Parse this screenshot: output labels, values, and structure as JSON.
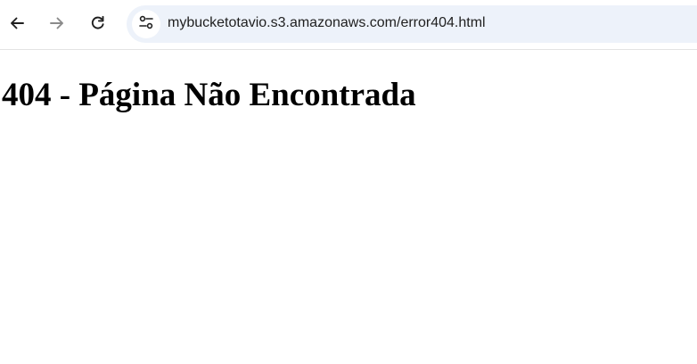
{
  "browser": {
    "url": "mybucketotavio.s3.amazonaws.com/error404.html",
    "icons": {
      "back": "arrow-left-icon",
      "forward": "arrow-right-icon",
      "reload": "reload-icon",
      "site_info": "tune-icon"
    },
    "colors": {
      "omnibox_bg": "#edf2fa",
      "icon_active": "#1f1f1f",
      "icon_disabled": "#8a8a8a"
    }
  },
  "page": {
    "heading": "404 - Página Não Encontrada"
  }
}
